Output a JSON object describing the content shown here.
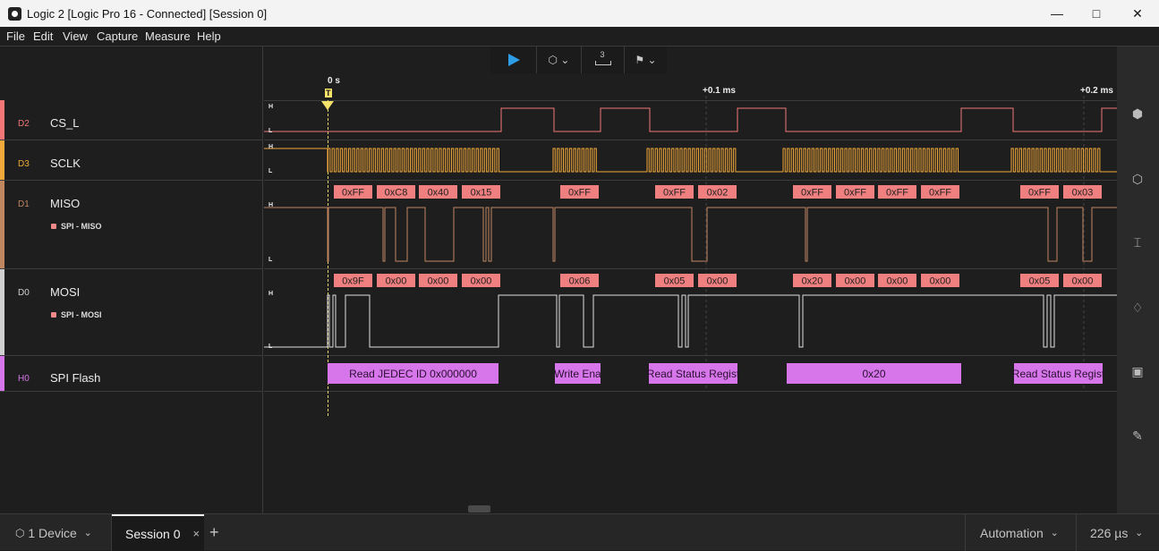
{
  "window": {
    "title": "Logic 2 [Logic Pro 16 - Connected] [Session 0]"
  },
  "menu": [
    "File",
    "Edit",
    "View",
    "Capture",
    "Measure",
    "Help"
  ],
  "toolbar": {
    "trigger_count": "3"
  },
  "timeline": {
    "marker_zero": "0 s",
    "marker_t": "T",
    "mark_1": "+0.1 ms",
    "mark_2": "+0.2 ms"
  },
  "levels": {
    "high": "H",
    "low": "L"
  },
  "channels": [
    {
      "id": "D2",
      "name": "CS_L",
      "color": "#f27878"
    },
    {
      "id": "D3",
      "name": "SCLK",
      "color": "#f2a93b"
    },
    {
      "id": "D1",
      "name": "MISO",
      "color": "#c08660",
      "analyzer": "SPI - MISO"
    },
    {
      "id": "D0",
      "name": "MOSI",
      "color": "#d0d0d0",
      "analyzer": "SPI - MOSI"
    },
    {
      "id": "H0",
      "name": "SPI Flash",
      "color": "#d676ea"
    }
  ],
  "miso_bytes": [
    "0xFF",
    "0xC8",
    "0x40",
    "0x15",
    "0xFF",
    "0xFF",
    "0x02",
    "0xFF",
    "0xFF",
    "0xFF",
    "0xFF",
    "0xFF",
    "0x03"
  ],
  "mosi_bytes": [
    "0x9F",
    "0x00",
    "0x00",
    "0x00",
    "0x06",
    "0x05",
    "0x00",
    "0x20",
    "0x00",
    "0x00",
    "0x00",
    "0x05",
    "0x00"
  ],
  "flash_frames": [
    "Read JEDEC ID 0x000000",
    "Write Ena",
    "Read Status Regist",
    "0x20",
    "Read Status Regist"
  ],
  "statusbar": {
    "device": "1 Device",
    "session": "Session 0",
    "close": "×",
    "add": "+",
    "automation": "Automation",
    "duration": "226 µs"
  }
}
